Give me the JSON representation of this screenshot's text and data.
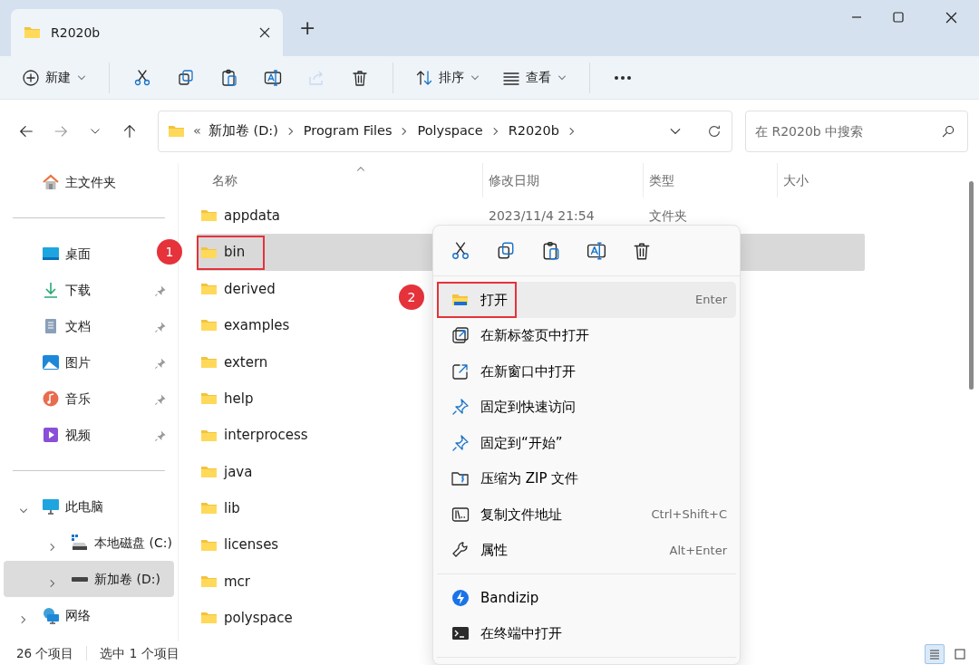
{
  "window": {
    "tab_title": "R2020b",
    "new_tab": "+"
  },
  "toolbar": [
    {
      "kind": "new",
      "label": "新建",
      "disabled": false
    },
    {
      "kind": "separator"
    },
    {
      "kind": "cut",
      "disabled": false
    },
    {
      "kind": "copy",
      "disabled": false
    },
    {
      "kind": "paste",
      "disabled": false
    },
    {
      "kind": "rename",
      "disabled": false
    },
    {
      "kind": "share",
      "disabled": true
    },
    {
      "kind": "delete",
      "disabled": false
    },
    {
      "kind": "separator"
    },
    {
      "kind": "sort",
      "label": "排序",
      "disabled": false
    },
    {
      "kind": "view",
      "label": "查看",
      "disabled": false
    },
    {
      "kind": "separator"
    },
    {
      "kind": "more",
      "disabled": false
    }
  ],
  "address": {
    "overflow": "«",
    "path": [
      "新加卷 (D:)",
      "Program Files",
      "Polyspace",
      "R2020b"
    ],
    "search_placeholder": "在 R2020b 中搜索"
  },
  "sidebar": {
    "sections": [
      {
        "items": [
          {
            "kind": "home",
            "label": "主文件夹",
            "selected": false
          }
        ]
      },
      {
        "items": [
          {
            "kind": "desktop",
            "label": "桌面",
            "pinned": false,
            "selected": false
          },
          {
            "kind": "download",
            "label": "下载",
            "pinned": true,
            "selected": false
          },
          {
            "kind": "document",
            "label": "文档",
            "pinned": true,
            "selected": false
          },
          {
            "kind": "picture",
            "label": "图片",
            "pinned": true,
            "selected": false
          },
          {
            "kind": "music",
            "label": "音乐",
            "pinned": true,
            "selected": false
          },
          {
            "kind": "video",
            "label": "视频",
            "pinned": true,
            "selected": false
          }
        ]
      },
      {
        "items": [
          {
            "kind": "pc",
            "label": "此电脑",
            "expanded": true,
            "selected": false,
            "children": [
              {
                "kind": "system-drive",
                "label": "本地磁盘 (C:)",
                "expanded": false,
                "selected": false
              },
              {
                "kind": "drive",
                "label": "新加卷 (D:)",
                "expanded": false,
                "selected": true
              }
            ]
          },
          {
            "kind": "network",
            "label": "网络",
            "expanded": false,
            "selected": false
          }
        ]
      }
    ]
  },
  "files": {
    "columns": [
      "名称",
      "修改日期",
      "类型",
      "大小"
    ],
    "rows": [
      {
        "name": "appdata",
        "date": "2023/11/4 21:54",
        "type": "文件夹",
        "selected": false
      },
      {
        "name": "bin",
        "selected": true,
        "annotation": "1"
      },
      {
        "name": "derived",
        "selected": false
      },
      {
        "name": "examples",
        "selected": false
      },
      {
        "name": "extern",
        "selected": false
      },
      {
        "name": "help",
        "selected": false
      },
      {
        "name": "interprocess",
        "selected": false
      },
      {
        "name": "java",
        "selected": false
      },
      {
        "name": "lib",
        "selected": false
      },
      {
        "name": "licenses",
        "selected": false
      },
      {
        "name": "mcr",
        "selected": false
      },
      {
        "name": "polyspace",
        "selected": false
      }
    ]
  },
  "context_menu": {
    "groups": [
      [
        {
          "label": "打开",
          "shortcut": "Enter",
          "selected": true,
          "annotation": "2"
        },
        {
          "label": "在新标签页中打开",
          "selected": false
        },
        {
          "label": "在新窗口中打开",
          "selected": false
        },
        {
          "label": "固定到快速访问",
          "selected": false
        },
        {
          "label": "固定到“开始”",
          "selected": false
        },
        {
          "label": "压缩为 ZIP 文件",
          "selected": false
        },
        {
          "label": "复制文件地址",
          "shortcut": "Ctrl+Shift+C",
          "selected": false
        },
        {
          "label": "属性",
          "shortcut": "Alt+Enter",
          "selected": false
        }
      ],
      [
        {
          "label": "Bandizip",
          "selected": false
        },
        {
          "label": "在终端中打开",
          "selected": false
        }
      ]
    ]
  },
  "status_bar": {
    "count": "26 个项目",
    "selection": "选中 1 个项目"
  }
}
